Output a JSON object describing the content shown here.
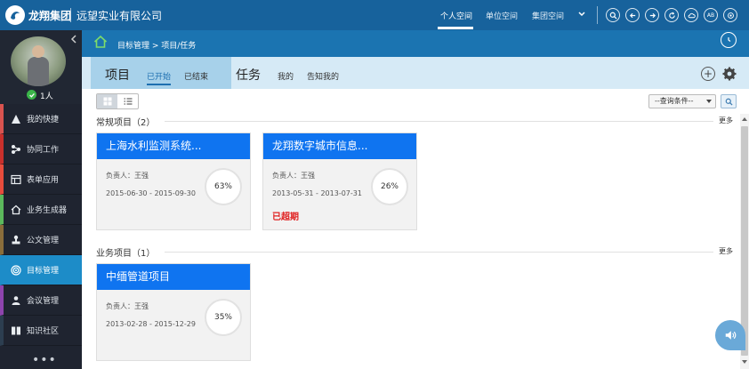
{
  "header": {
    "brand": "龙翔集团",
    "company": "远望实业有限公司",
    "nav": [
      "个人空间",
      "单位空间",
      "集团空间"
    ],
    "active_nav": "个人空间",
    "icons": [
      "search-icon",
      "back-icon",
      "forward-icon",
      "refresh-icon",
      "cloud-icon",
      "ab-icon",
      "target-icon"
    ],
    "ab_label": "AB"
  },
  "sidebar": {
    "online_count": "1人",
    "items": [
      {
        "label": "我的快捷",
        "icon": "lightning-icon",
        "accent": "#d9534f"
      },
      {
        "label": "协同工作",
        "icon": "flow-icon",
        "accent": "#c9302c"
      },
      {
        "label": "表单应用",
        "icon": "form-icon",
        "accent": "#e74c3c"
      },
      {
        "label": "业务生成器",
        "icon": "house-icon",
        "accent": "#5cb85c"
      },
      {
        "label": "公文管理",
        "icon": "stamp-icon",
        "accent": "#8a6d3b"
      },
      {
        "label": "目标管理",
        "icon": "target-icon",
        "accent": "#1d8cc8"
      },
      {
        "label": "会议管理",
        "icon": "meeting-icon",
        "accent": "#8e44ad"
      },
      {
        "label": "知识社区",
        "icon": "book-icon",
        "accent": "#2c3e50"
      }
    ],
    "more": "•••"
  },
  "breadcrumb": "目标管理 > 项目/任务",
  "tabs": {
    "project_title": "项目",
    "project_links": [
      "已开始",
      "已结束"
    ],
    "task_title": "任务",
    "task_links": [
      "我的",
      "告知我的"
    ]
  },
  "toolbar": {
    "query_placeholder": "--查询条件--"
  },
  "sections": [
    {
      "title": "常规项目（2）",
      "more": "更多",
      "cards": [
        {
          "title": "上海水利监测系统...",
          "owner": "负责人：王强",
          "dates": "2015-06-30 - 2015-09-30",
          "progress": "63%",
          "overdue": ""
        },
        {
          "title": "龙翔数字城市信息...",
          "owner": "负责人：王强",
          "dates": "2013-05-31 - 2013-07-31",
          "progress": "26%",
          "overdue": "已超期"
        }
      ]
    },
    {
      "title": "业务项目（1）",
      "more": "更多",
      "cards": [
        {
          "title": "中缅管道项目",
          "owner": "负责人：王强",
          "dates": "2013-02-28 - 2015-12-29",
          "progress": "35%",
          "overdue": ""
        }
      ]
    }
  ],
  "colors": {
    "topbar": "#17629c",
    "card_header": "#0f74f0",
    "active_menu": "#1d8cc8",
    "overdue": "#e02020"
  }
}
